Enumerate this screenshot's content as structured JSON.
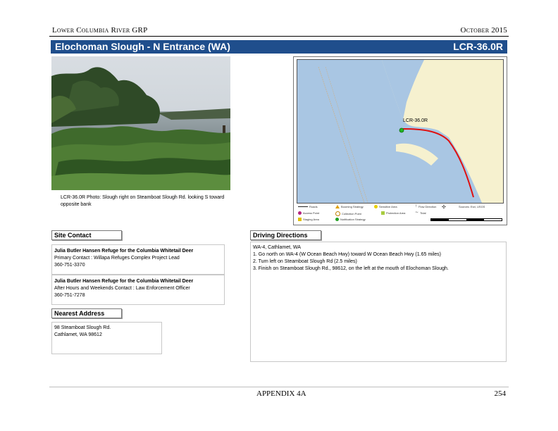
{
  "header": {
    "left": "Lower Columbia River GRP",
    "right": "October 2015"
  },
  "title_bar": {
    "title": "Elochoman Slough - N Entrance (WA)",
    "code": "LCR-36.0R"
  },
  "photo": {
    "caption": "LCR-36.0R Photo: Slough right on Steamboat Slough Rd. looking S toward opposite bank"
  },
  "map": {
    "site_label": "LCR-36.0R",
    "colors": {
      "water": "#a9c6e3",
      "land": "#f6f1cf",
      "route": "#e01010",
      "marker": "#22b422"
    },
    "legend": [
      {
        "icon": "road-line-icon",
        "label": "Roads"
      },
      {
        "icon": "access-point-icon",
        "label": "Access Point"
      },
      {
        "icon": "staging-area-icon",
        "label": "Staging Area"
      },
      {
        "icon": "booming-strategy-icon",
        "label": "Booming Strategy"
      },
      {
        "icon": "collection-point-icon",
        "label": "Collection Point"
      },
      {
        "icon": "notification-icon",
        "label": "Notification Strategy"
      },
      {
        "icon": "sensitive-area-icon",
        "label": "Sensitive Area"
      },
      {
        "icon": "protection-area-icon",
        "label": "Protection Area"
      },
      {
        "icon": "north-arrow-icon",
        "label": "Flow Direction"
      },
      {
        "icon": "tide-icon",
        "label": "Tidal"
      },
      {
        "icon": "compass-icon",
        "label": ""
      },
      {
        "icon": "source-label",
        "label": "Sources: Esri, USGS"
      }
    ]
  },
  "site_contact": {
    "label": "Site Contact",
    "contacts": [
      {
        "org": "Julia Butler Hansen Refuge for the Columbia Whitetail Deer",
        "role": "Primary Contact : Willapa Refuges Complex Project Lead",
        "phone": "360-751-3370"
      },
      {
        "org": "Julia Butler Hansen Refuge for the Columbia Whitetail Deer",
        "role": "After Hours and Weekends Contact : Law Enforcement Officer",
        "phone": "360-751-7278"
      }
    ]
  },
  "nearest_address": {
    "label": "Nearest Address",
    "line1": "98 Steamboat Slough Rd.",
    "line2": "Cathlamet, WA 98612"
  },
  "driving_directions": {
    "label": "Driving Directions",
    "lines": [
      "WA-4, Cathlamet, WA",
      "1. Go north on WA-4 (W Ocean Beach Hwy) toward W Ocean Beach Hwy (1.65 miles)",
      "2. Turn left on Steamboat Slough Rd (2.5 miles)",
      "3. Finish on Steamboat Slough Rd., 98612, on the left at the mouth of Elochoman Slough."
    ]
  },
  "footer": {
    "center": "APPENDIX 4A",
    "page": "254"
  }
}
